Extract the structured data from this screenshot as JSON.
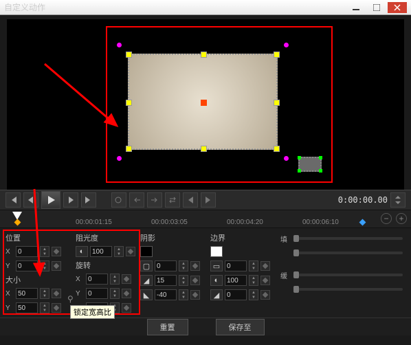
{
  "window": {
    "title": "自定义动作"
  },
  "transport": {
    "timecode": "0:00:00.00"
  },
  "timeline": {
    "ticks": [
      "00:00:01:15",
      "00:00:03:05",
      "00:00:04:20",
      "00:00:06:10"
    ]
  },
  "props": {
    "position": {
      "label": "位置",
      "x": "0",
      "y": "0"
    },
    "size": {
      "label": "大小",
      "x": "50",
      "y": "50"
    },
    "opacity": {
      "label": "阻光度",
      "val": "100"
    },
    "rotation": {
      "label": "旋转",
      "x": "0",
      "y": "0",
      "z": "0"
    },
    "shadow": {
      "label": "阴影",
      "a": "0",
      "b": "15",
      "c": "-40"
    },
    "border": {
      "label": "边界",
      "a": "0",
      "b": "100",
      "c": "0"
    },
    "fill": {
      "label1": "填",
      "label2": "缓"
    }
  },
  "tooltip": "锁定宽高比",
  "buttons": {
    "reset": "重置",
    "save": "保存至"
  }
}
